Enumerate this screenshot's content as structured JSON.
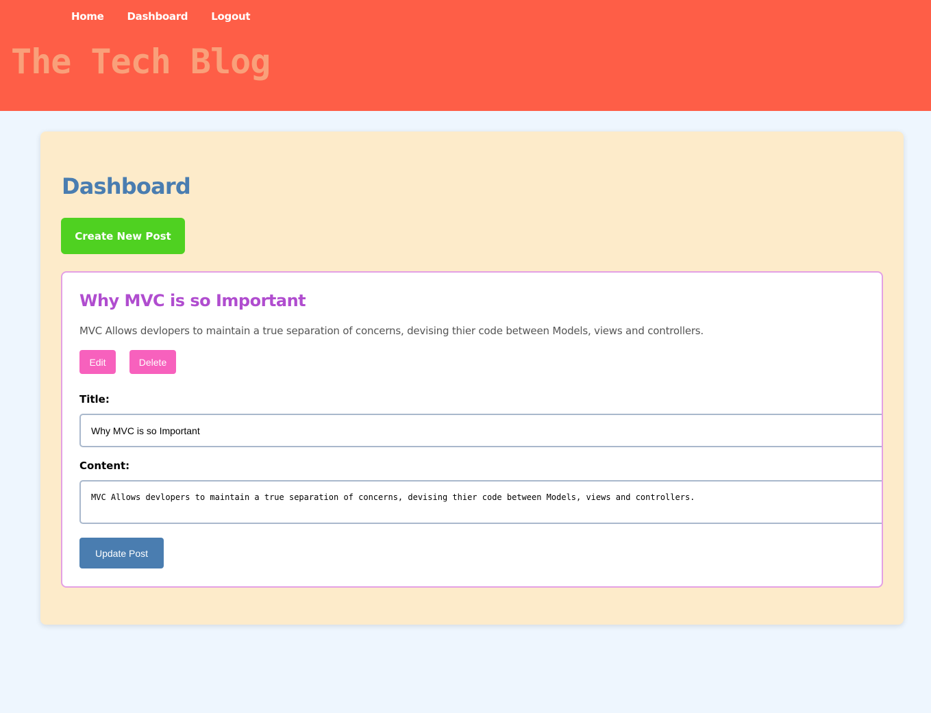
{
  "nav": {
    "items": [
      "Home",
      "Dashboard",
      "Logout"
    ]
  },
  "site": {
    "title": "The Tech Blog"
  },
  "dashboard": {
    "heading": "Dashboard",
    "create_button": "Create New Post"
  },
  "post": {
    "title": "Why MVC is so Important",
    "content": "MVC Allows devlopers to maintain a true separation of concerns, devising thier code between Models, views and controllers.",
    "edit_label": "Edit",
    "delete_label": "Delete",
    "form": {
      "title_label": "Title:",
      "title_value": "Why MVC is so Important",
      "content_label": "Content:",
      "content_value": "MVC Allows devlopers to maintain a true separation of concerns, devising thier code between Models, views and controllers.",
      "update_label": "Update Post"
    }
  },
  "colors": {
    "header_bg": "#fe5e47",
    "site_title": "#f9a07a",
    "page_bg": "#eef6fe",
    "card_bg": "#fdebca",
    "dashboard_title": "#4a7db0",
    "create_button": "#4fd121",
    "post_border": "#e3a0e4",
    "post_title": "#b04dcf",
    "action_button": "#f761bd",
    "update_button": "#4a7db0"
  }
}
